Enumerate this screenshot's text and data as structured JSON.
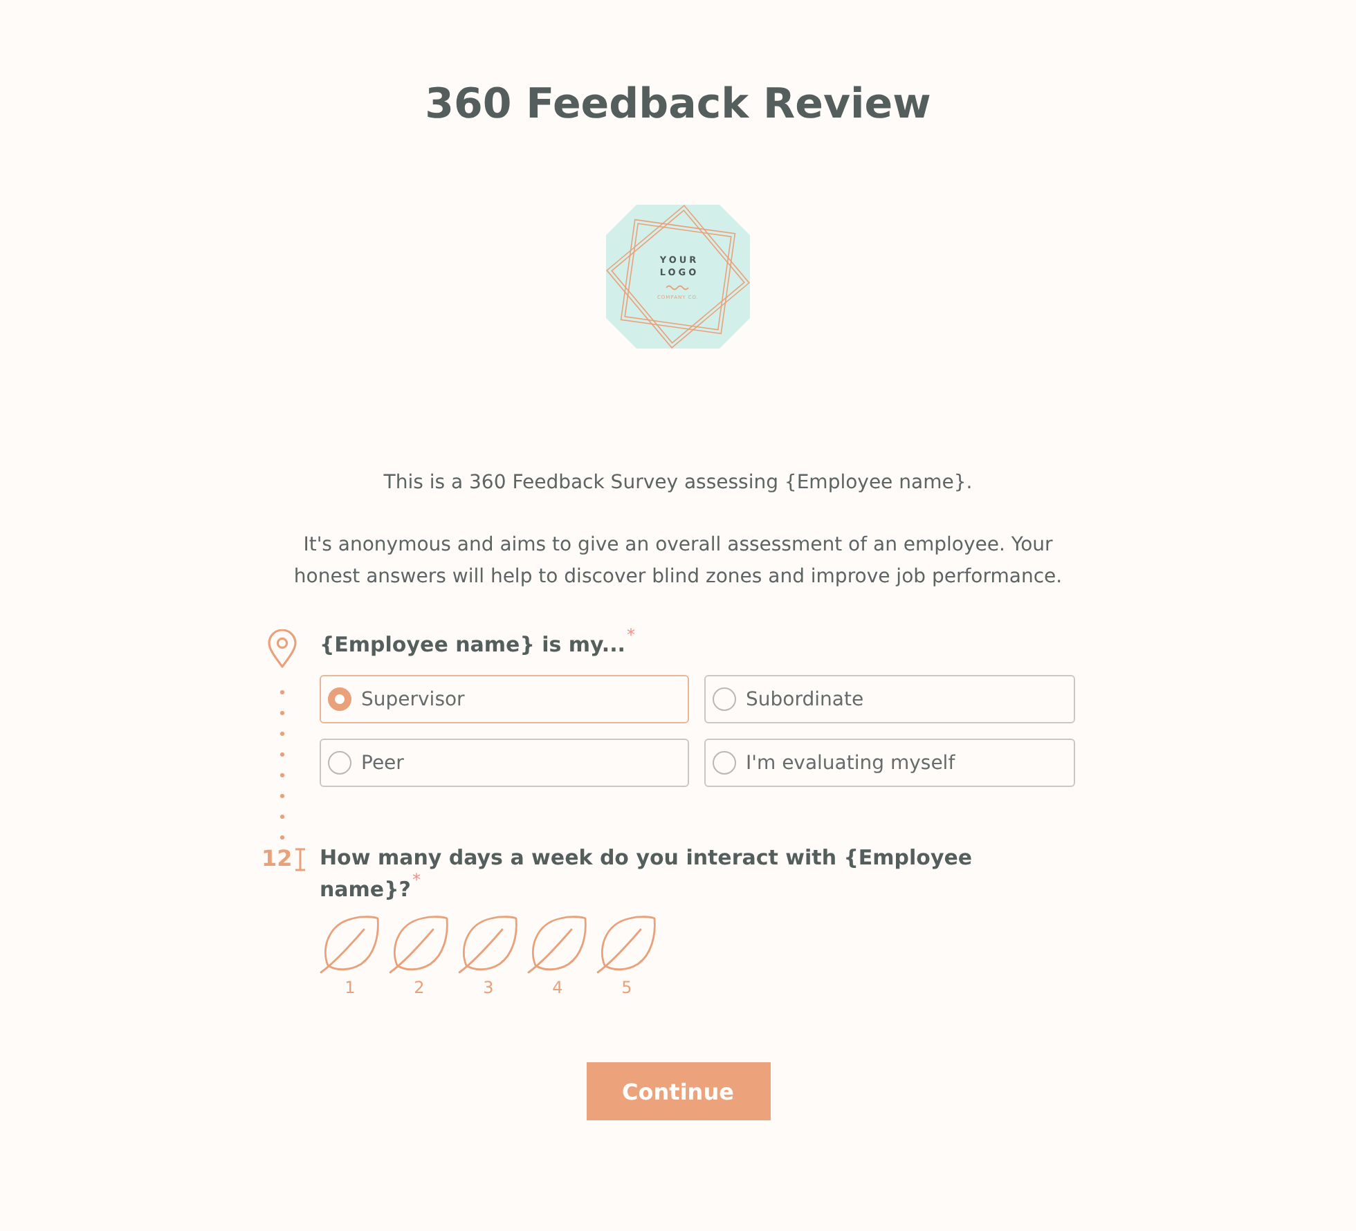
{
  "title": "360 Feedback Review",
  "logo": {
    "lines": [
      "YOUR",
      "LOGO"
    ],
    "tagline": "COMPANY CO."
  },
  "intro": [
    "This is a 360 Feedback Survey assessing {Employee name}.",
    "It's anonymous and aims to give an overall assessment of an employee. Your honest answers will help to discover blind zones and improve job performance."
  ],
  "questions": [
    {
      "kind": "choice",
      "text": "{Employee name} is my...",
      "required_mark": "*",
      "options": [
        {
          "label": "Supervisor",
          "selected": true
        },
        {
          "label": "Subordinate",
          "selected": false
        },
        {
          "label": "Peer",
          "selected": false
        },
        {
          "label": "I'm evaluating myself",
          "selected": false
        }
      ]
    },
    {
      "kind": "rating",
      "number_label": "12",
      "text": "How many days a week do you interact with {Employee name}?",
      "required_mark": "*",
      "stars": 0,
      "scale": [
        "1",
        "2",
        "3",
        "4",
        "5"
      ]
    }
  ],
  "continue_button": "Continue"
}
